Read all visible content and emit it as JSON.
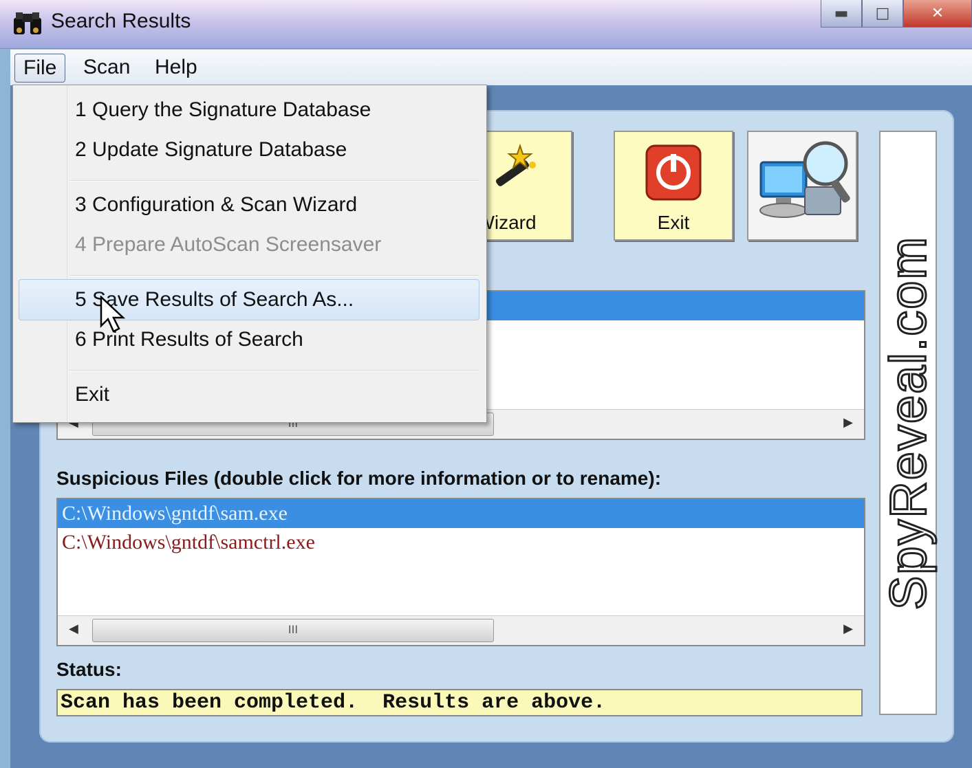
{
  "window": {
    "title": "Search Results"
  },
  "menubar": {
    "items": [
      "File",
      "Scan",
      "Help"
    ]
  },
  "file_menu": {
    "items": [
      {
        "label": "1 Query the Signature Database",
        "enabled": true
      },
      {
        "label": "2 Update Signature Database",
        "enabled": true
      },
      {
        "label": "3 Configuration & Scan Wizard",
        "enabled": true
      },
      {
        "label": "4 Prepare AutoScan Screensaver",
        "enabled": false
      },
      {
        "label": "5 Save Results of Search As...",
        "enabled": true,
        "highlighted": true
      },
      {
        "label": "6 Print Results of Search",
        "enabled": true
      },
      {
        "label": "Exit",
        "enabled": true
      }
    ]
  },
  "toolbar": {
    "wizard_label": "Wizard",
    "exit_label": "Exit"
  },
  "suspicious": {
    "heading": "Suspicious Files (double click for more information or to rename):",
    "files": [
      "C:\\Windows\\gntdf\\sam.exe",
      "C:\\Windows\\gntdf\\samctrl.exe"
    ]
  },
  "scrollbar": {
    "thumb_grip": "III"
  },
  "status": {
    "label": "Status:",
    "text": "Scan has been completed.  Results are above."
  },
  "brand": {
    "text": "SpyReveal.com"
  },
  "colors": {
    "selection": "#3b8fe3",
    "suspicious_text": "#8b1a1a",
    "button_face": "#fdfbc0",
    "status_bg": "#fbf9b9"
  }
}
